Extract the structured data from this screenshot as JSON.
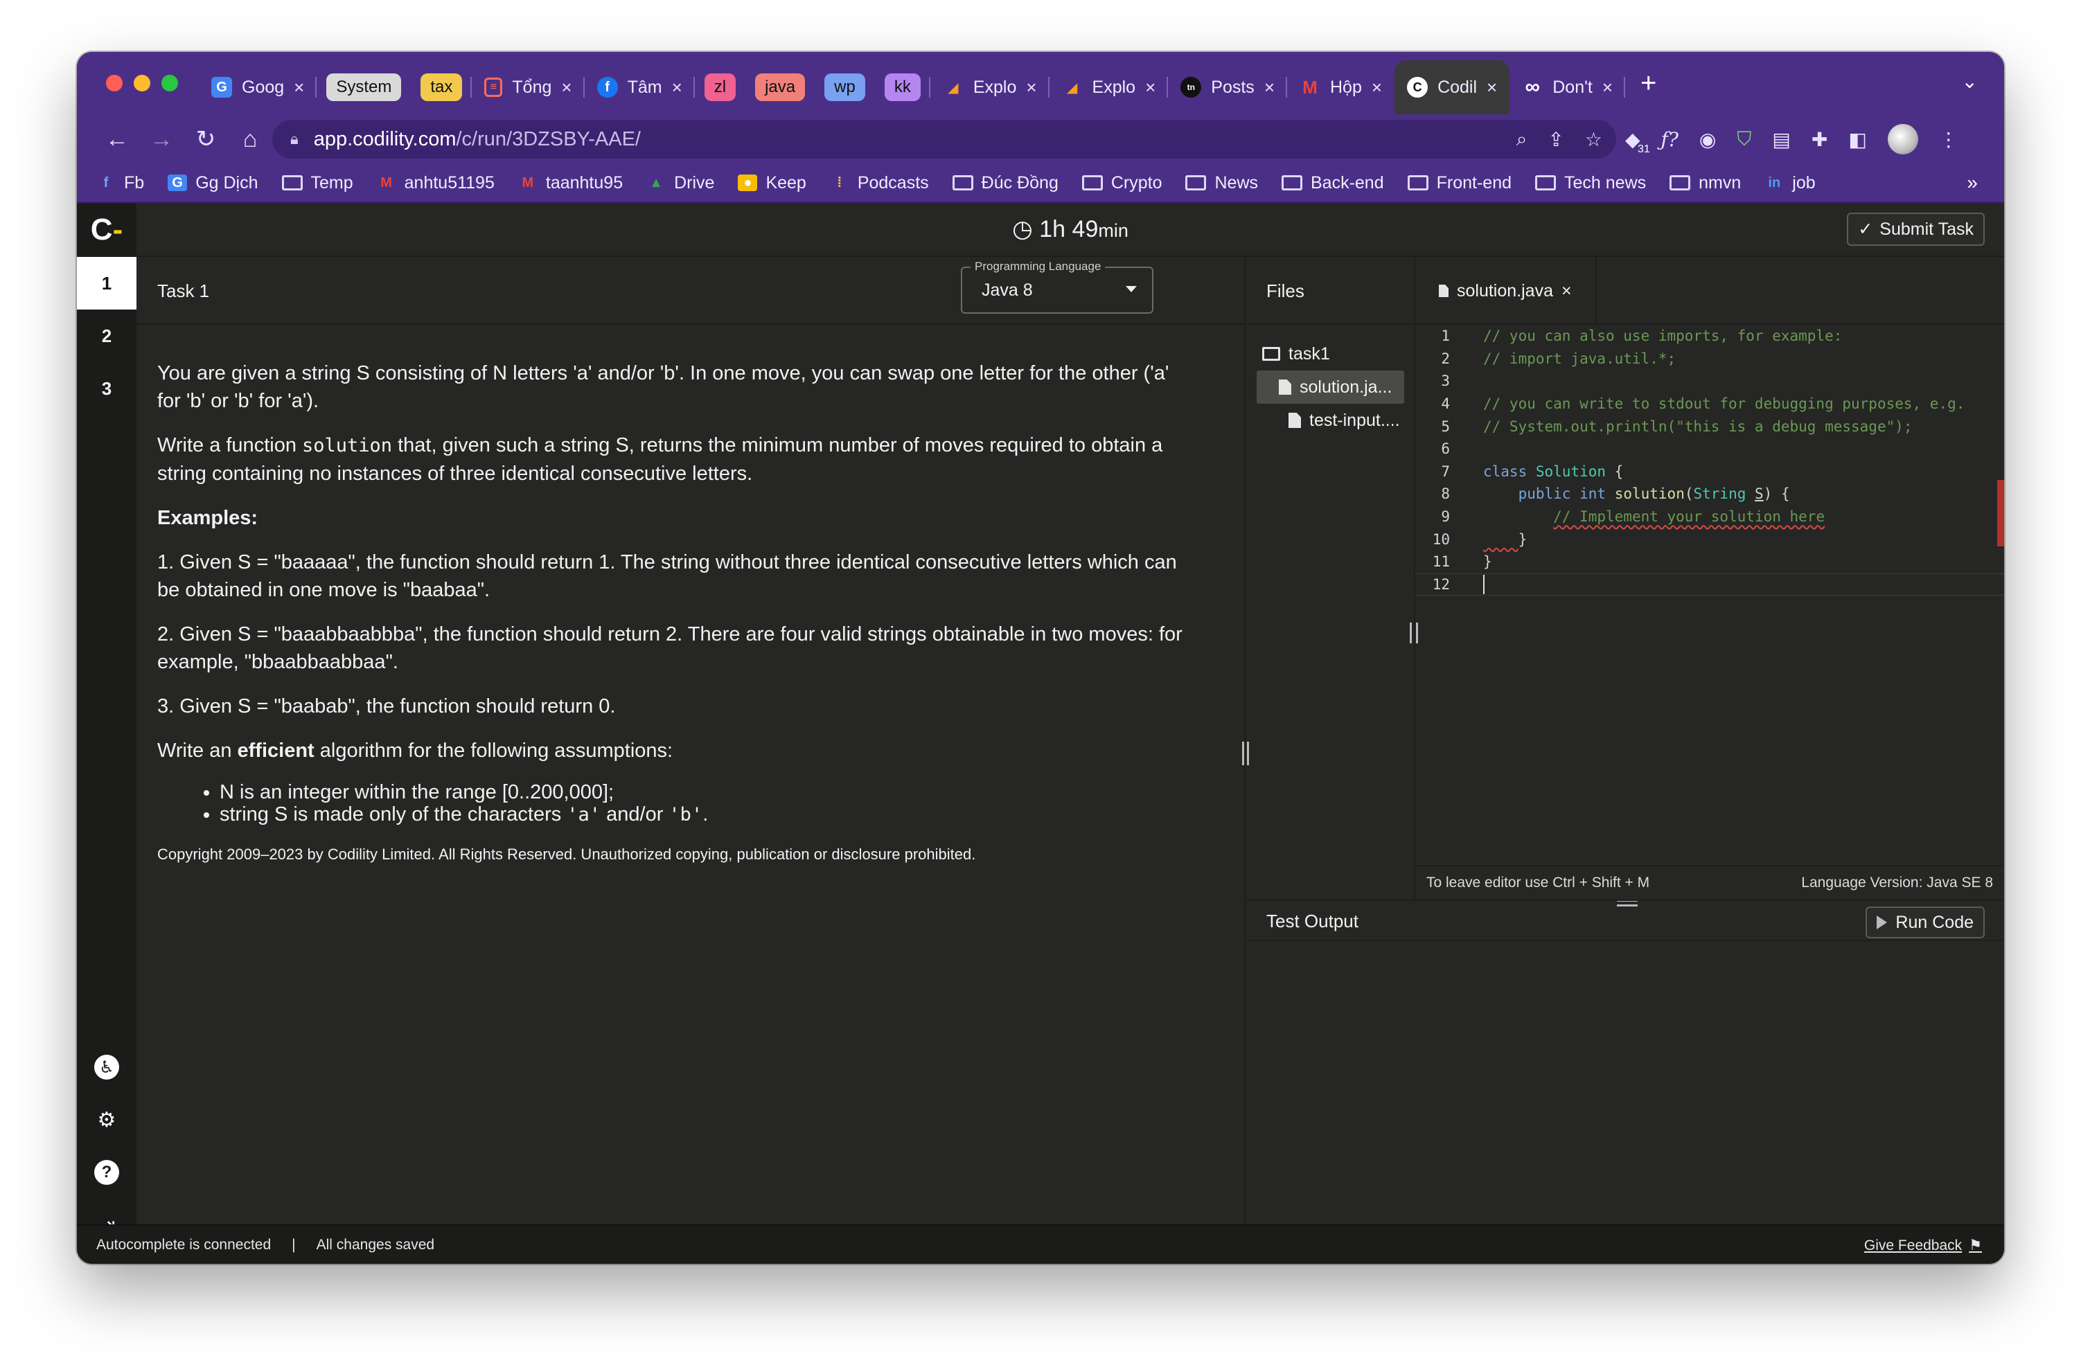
{
  "browser": {
    "tabs": [
      {
        "label": "Goog",
        "icon": "google-translate-icon",
        "color": "#4285f4"
      },
      {
        "label": "System",
        "pill_color": "#d9d9d9"
      },
      {
        "label": "tax",
        "pill_color": "#f2c94c"
      },
      {
        "label": "Tổng",
        "icon": "document-icon",
        "color": "#e44d3a"
      },
      {
        "label": "Tâm",
        "icon": "facebook-icon",
        "color": "#1877f2"
      },
      {
        "label": "zl",
        "pill_color": "#f06292"
      },
      {
        "label": "java",
        "pill_color": "#f0817a"
      },
      {
        "label": "wp",
        "pill_color": "#7aa0f0"
      },
      {
        "label": "kk",
        "pill_color": "#b386f0"
      },
      {
        "label": "Explo",
        "icon": "leetcode-icon",
        "color": "#f89f1b"
      },
      {
        "label": "Explo",
        "icon": "leetcode-icon",
        "color": "#f89f1b"
      },
      {
        "label": "Posts",
        "icon": "tabnews-icon",
        "color": "#111111"
      },
      {
        "label": "Hộp",
        "icon": "gmail-icon",
        "color": "#ea4335"
      },
      {
        "label": "Codil",
        "icon": "codility-icon",
        "color": "#ffffff"
      },
      {
        "label": "Don't",
        "icon": "infinity-icon",
        "color": "#ffffff"
      }
    ],
    "url_host": "app.codility.com",
    "url_path": "/c/run/3DZSBY-AAE/",
    "extension_badge": "31",
    "bookmarks": [
      "Fb",
      "Gg Dịch",
      "Temp",
      "anhtu51195",
      "taanhtu95",
      "Drive",
      "Keep",
      "Podcasts",
      "Đúc Đồng",
      "Crypto",
      "News",
      "Back-end",
      "Front-end",
      "Tech news",
      "nmvn",
      "job"
    ],
    "bookmarks_more": "»"
  },
  "app": {
    "logo": "C",
    "tasks": [
      "1",
      "2",
      "3"
    ],
    "timer": {
      "hours": "1h",
      "minutes": "49",
      "unit": "min"
    },
    "submit_label": "Submit Task",
    "task_title": "Task 1",
    "language_legend": "Programming Language",
    "language_value": "Java 8",
    "files_title": "Files",
    "folder": "task1",
    "files": [
      "solution.ja...",
      "test-input...."
    ],
    "editor_tab": "solution.java",
    "editor_hint": "To leave editor use Ctrl + Shift + M",
    "language_version": "Language Version: Java SE 8",
    "test_output": "Test Output",
    "run_label": "Run Code",
    "status_left": "Autocomplete is connected",
    "status_sep": "|",
    "status_saved": "All changes saved",
    "feedback": "Give Feedback"
  },
  "task": {
    "p1": "You are given a string S consisting of N letters 'a' and/or 'b'. In one move, you can swap one letter for the other ('a' for 'b' or 'b' for 'a').",
    "p2_a": "Write a function ",
    "p2_code": "solution",
    "p2_b": " that, given such a string S, returns the minimum number of moves required to obtain a string containing no instances of three identical consecutive letters.",
    "examples": "Examples:",
    "ex1": "1. Given S = \"baaaaa\", the function should return 1. The string without three identical consecutive letters which can be obtained in one move is \"baabaa\".",
    "ex2": "2. Given S = \"baaabbaabbba\", the function should return 2. There are four valid strings obtainable in two moves: for example, \"bbaabbaabbaa\".",
    "ex3": "3. Given S = \"baabab\", the function should return 0.",
    "assume_a": "Write an ",
    "assume_b": "efficient",
    "assume_c": " algorithm for the following assumptions:",
    "li1": "N is an integer within the range [0..200,000];",
    "li2_a": "string S is made only of the characters ",
    "li2_c1": "'a'",
    "li2_mid": " and/or ",
    "li2_c2": "'b'",
    "li2_end": ".",
    "copyright": "Copyright 2009–2023 by Codility Limited. All Rights Reserved. Unauthorized copying, publication or disclosure prohibited."
  },
  "code": {
    "l1": "// you can also use imports, for example:",
    "l2": "// import java.util.*;",
    "l4": "// you can write to stdout for debugging purposes, e.g.",
    "l5": "// System.out.println(\"this is a debug message\");",
    "l7_kw": "class",
    "l7_ty": "Solution",
    "l7_end": " {",
    "l8_kw1": "public",
    "l8_kw2": "int",
    "l8_fn": "solution",
    "l8_ty": "String",
    "l8_arg": "S",
    "l8_end": ") {",
    "l9": "// Implement your solution here",
    "l10": "}",
    "l11": "}",
    "line_numbers": [
      "1",
      "2",
      "3",
      "4",
      "5",
      "6",
      "7",
      "8",
      "9",
      "10",
      "11",
      "12"
    ]
  }
}
